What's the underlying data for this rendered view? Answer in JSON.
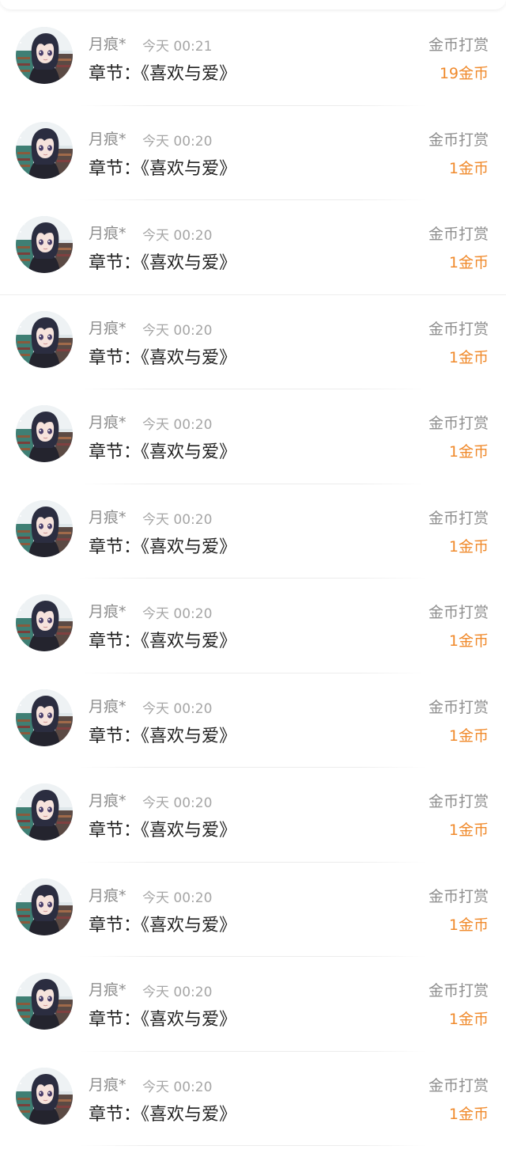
{
  "records": [
    {
      "user": "月痕*",
      "time": "今天 00:21",
      "chapter": "章节：《喜欢与爱》",
      "reward_type": "金币打赏",
      "amount": "19金币"
    },
    {
      "user": "月痕*",
      "time": "今天 00:20",
      "chapter": "章节：《喜欢与爱》",
      "reward_type": "金币打赏",
      "amount": "1金币"
    },
    {
      "user": "月痕*",
      "time": "今天 00:20",
      "chapter": "章节：《喜欢与爱》",
      "reward_type": "金币打赏",
      "amount": "1金币"
    },
    {
      "user": "月痕*",
      "time": "今天 00:20",
      "chapter": "章节：《喜欢与爱》",
      "reward_type": "金币打赏",
      "amount": "1金币"
    },
    {
      "user": "月痕*",
      "time": "今天 00:20",
      "chapter": "章节：《喜欢与爱》",
      "reward_type": "金币打赏",
      "amount": "1金币"
    },
    {
      "user": "月痕*",
      "time": "今天 00:20",
      "chapter": "章节：《喜欢与爱》",
      "reward_type": "金币打赏",
      "amount": "1金币"
    },
    {
      "user": "月痕*",
      "time": "今天 00:20",
      "chapter": "章节：《喜欢与爱》",
      "reward_type": "金币打赏",
      "amount": "1金币"
    },
    {
      "user": "月痕*",
      "time": "今天 00:20",
      "chapter": "章节：《喜欢与爱》",
      "reward_type": "金币打赏",
      "amount": "1金币"
    },
    {
      "user": "月痕*",
      "time": "今天 00:20",
      "chapter": "章节：《喜欢与爱》",
      "reward_type": "金币打赏",
      "amount": "1金币"
    },
    {
      "user": "月痕*",
      "time": "今天 00:20",
      "chapter": "章节：《喜欢与爱》",
      "reward_type": "金币打赏",
      "amount": "1金币"
    },
    {
      "user": "月痕*",
      "time": "今天 00:20",
      "chapter": "章节：《喜欢与爱》",
      "reward_type": "金币打赏",
      "amount": "1金币"
    },
    {
      "user": "月痕*",
      "time": "今天 00:20",
      "chapter": "章节：《喜欢与爱》",
      "reward_type": "金币打赏",
      "amount": "1金币"
    }
  ],
  "colors": {
    "amount": "#f08a2c",
    "secondary_text": "#8f8f8f",
    "primary_text": "#222222"
  },
  "icons": {
    "avatar": "anime-avatar-icon"
  }
}
